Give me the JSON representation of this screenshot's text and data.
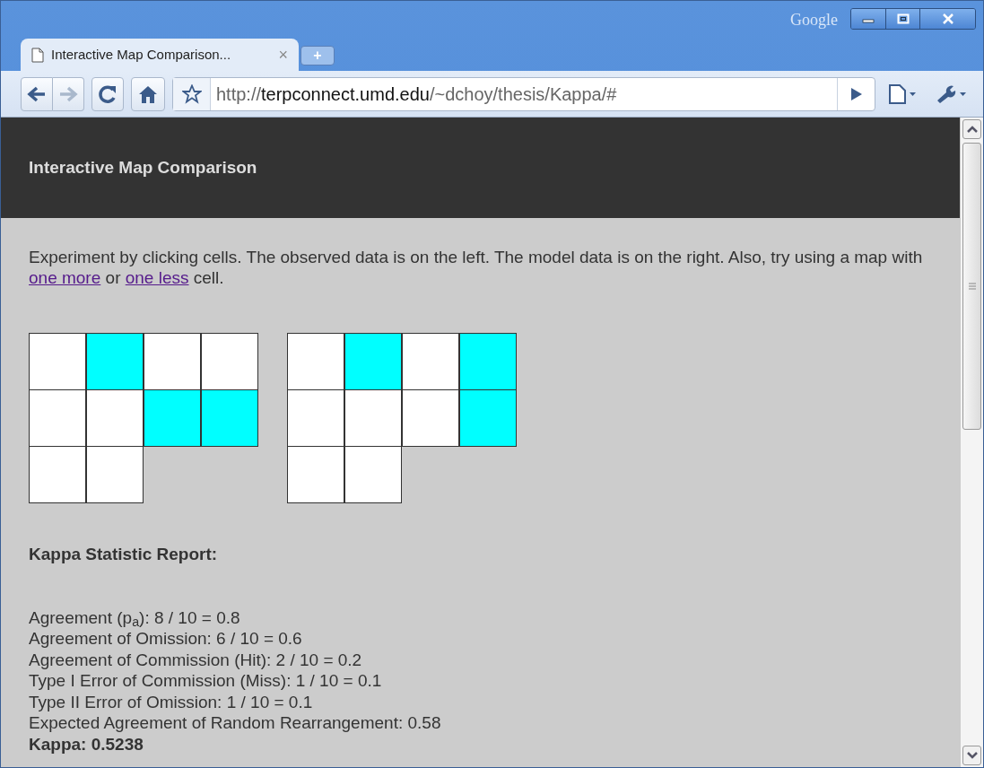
{
  "window": {
    "brand": "Google",
    "tab": {
      "title": "Interactive Map Comparison...",
      "close": "×",
      "selected": true
    },
    "new_tab": "+"
  },
  "toolbar": {
    "url_scheme": "http://",
    "url_host": "terpconnect.umd.edu",
    "url_path": "/~dchoy/thesis/Kappa/#"
  },
  "page": {
    "header": "Interactive Map Comparison",
    "intro": [
      {
        "kind": "text",
        "text": "Experiment by clicking cells. The observed data is on the left. The model data is on the right. Also, try using a map with "
      },
      {
        "kind": "link",
        "text": "one more"
      },
      {
        "kind": "text",
        "text": " or "
      },
      {
        "kind": "link",
        "text": "one less"
      },
      {
        "kind": "text",
        "text": " cell."
      }
    ],
    "maps": [
      {
        "rows": [
          [
            {
              "selected": false
            },
            {
              "selected": true
            },
            {
              "selected": false
            },
            {
              "selected": false
            }
          ],
          [
            {
              "selected": false
            },
            {
              "selected": false
            },
            {
              "selected": true
            },
            {
              "selected": true
            }
          ],
          [
            {
              "selected": false
            },
            {
              "selected": false
            }
          ]
        ]
      },
      {
        "rows": [
          [
            {
              "selected": false
            },
            {
              "selected": true
            },
            {
              "selected": false
            },
            {
              "selected": true
            }
          ],
          [
            {
              "selected": false
            },
            {
              "selected": false
            },
            {
              "selected": false
            },
            {
              "selected": true
            }
          ],
          [
            {
              "selected": false
            },
            {
              "selected": false
            }
          ]
        ]
      }
    ],
    "report_title": "Kappa Statistic Report:",
    "report": [
      {
        "kind": "line",
        "text": "Agreement (p$_{a}$): 8 / 10 = 0.8"
      },
      {
        "kind": "line",
        "text": "Agreement of Omission: 6 / 10 = 0.6"
      },
      {
        "kind": "line",
        "text": "Agreement of Commission (Hit): 2 / 10 = 0.2"
      },
      {
        "kind": "line",
        "text": "Type I Error of Commission (Miss): 1 / 10 = 0.1"
      },
      {
        "kind": "line",
        "text": "Type II Error of Omission: 1 / 10 = 0.1"
      },
      {
        "kind": "line",
        "text": "Expected Agreement of Random Rearrangement: 0.58"
      },
      {
        "kind": "total",
        "text": "Kappa: 0.5238"
      }
    ]
  }
}
